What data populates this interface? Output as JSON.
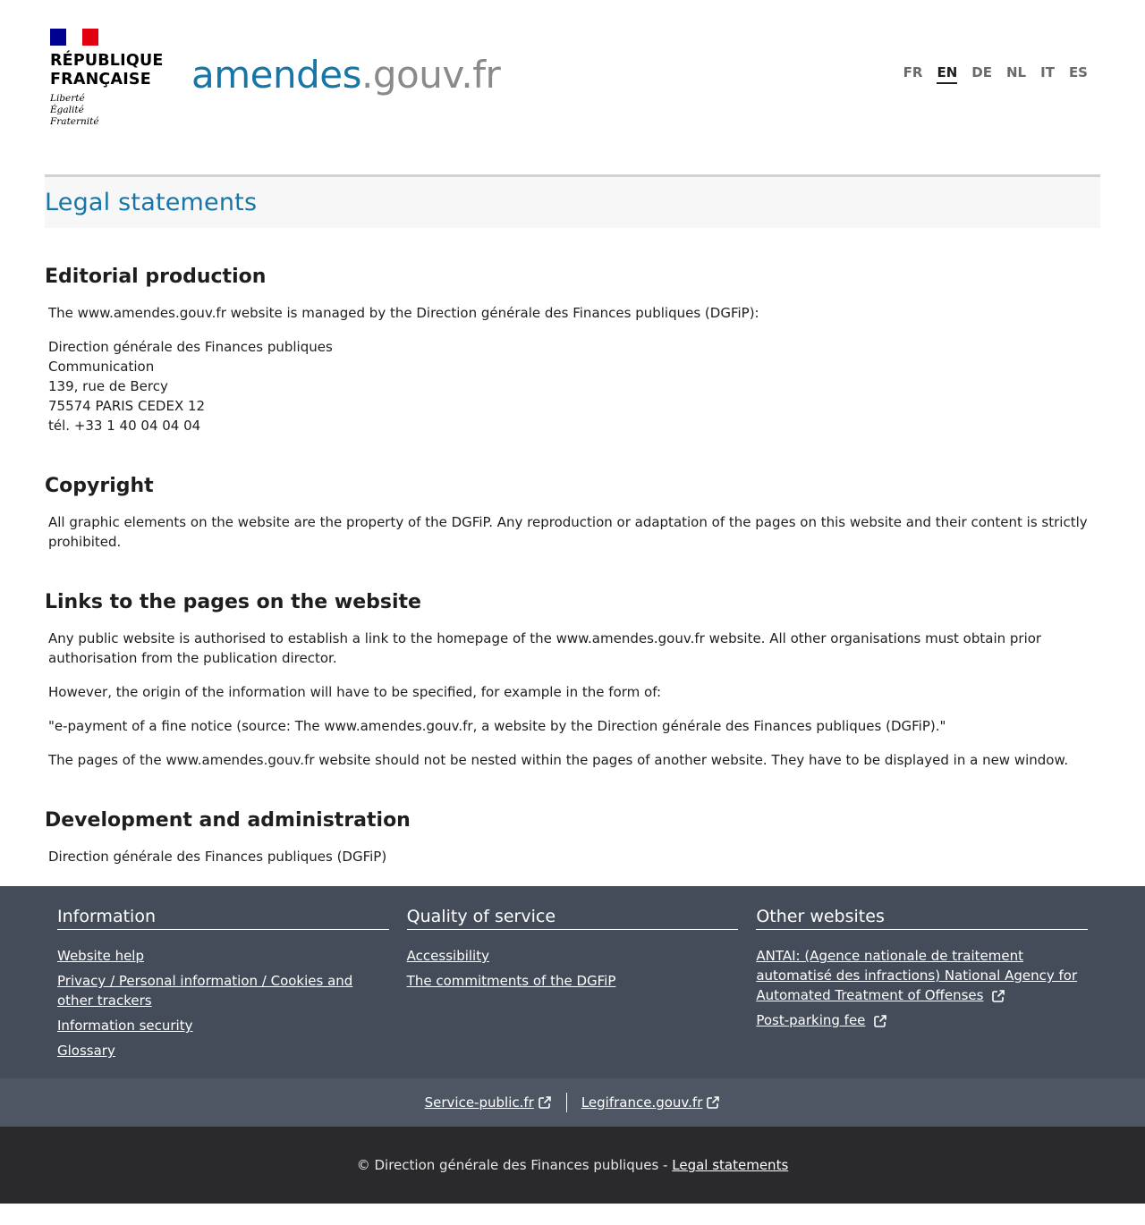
{
  "header": {
    "rf_line1": "RÉPUBLIQUE",
    "rf_line2": "FRANÇAISE",
    "motto": [
      "Liberté",
      "Égalité",
      "Fraternité"
    ],
    "site_logo_part1": "amendes",
    "site_logo_part2": ".gouv.fr",
    "languages": [
      "FR",
      "EN",
      "DE",
      "NL",
      "IT",
      "ES"
    ],
    "active_language": "EN"
  },
  "page": {
    "title": "Legal statements",
    "sections": {
      "editorial": {
        "title": "Editorial production",
        "intro": "The www.amendes.gouv.fr website is managed by the Direction générale des Finances publiques (DGFiP):",
        "address": [
          "Direction générale des Finances publiques",
          "Communication",
          "139, rue de Bercy",
          "75574 PARIS CEDEX 12",
          "tél. +33 1 40 04 04 04"
        ]
      },
      "copyright": {
        "title": "Copyright",
        "text": "All graphic elements on the website are the property of the DGFiP. Any reproduction or adaptation of the pages on this website and their content is strictly prohibited."
      },
      "links": {
        "title": "Links to the pages on the website",
        "p1": "Any public website is authorised to establish a link to the homepage of the www.amendes.gouv.fr website. All other organisations must obtain prior authorisation from the publication director.",
        "p2": "However, the origin of the information will have to be specified, for example in the form of:",
        "p3": "\"e-payment of a fine notice (source: The www.amendes.gouv.fr, a website by the Direction générale des Finances publiques (DGFiP).\"",
        "p4": "The pages of the www.amendes.gouv.fr website should not be nested within the pages of another website. They have to be displayed in a new window."
      },
      "development": {
        "title": "Development and administration",
        "text": "Direction générale des Finances publiques (DGFiP)"
      }
    }
  },
  "footer": {
    "columns": {
      "information": {
        "title": "Information",
        "links": [
          "Website help",
          "Privacy / Personal information / Cookies and other trackers",
          "Information security",
          "Glossary"
        ]
      },
      "quality": {
        "title": "Quality of service",
        "links": [
          "Accessibility",
          "The commitments of the DGFiP"
        ]
      },
      "other": {
        "title": "Other websites",
        "links": [
          "ANTAI: (Agence nationale de traitement automatisé des infractions) National Agency for Automated Treatment of Offenses",
          "Post-parking fee"
        ]
      }
    },
    "partner_links": [
      "Service-public.fr",
      "Legifrance.gouv.fr"
    ],
    "copyright_text": "© Direction générale des Finances publiques - ",
    "legal_link": "Legal statements"
  },
  "icons": {
    "external": "external-link-icon"
  },
  "colors": {
    "accent_blue": "#1776a8",
    "footer_dark": "#444c59",
    "footer_mid": "#4f5663",
    "footer_bottom": "#2a2a2c",
    "flag_blue": "#000091",
    "flag_red": "#e1000f"
  }
}
